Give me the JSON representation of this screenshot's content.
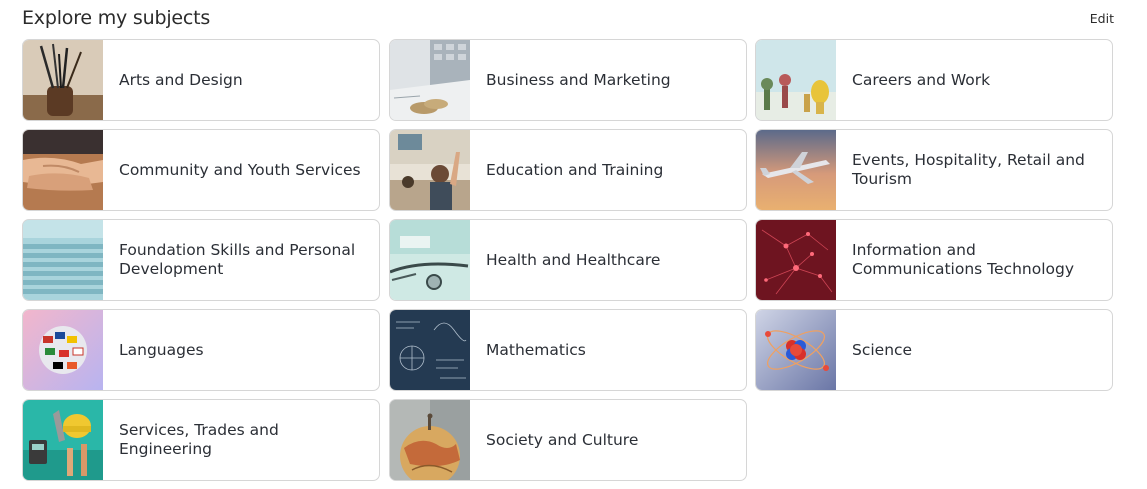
{
  "header": {
    "title": "Explore my subjects",
    "edit_label": "Edit"
  },
  "subjects": [
    {
      "label": "Arts and Design",
      "icon": "art-brushes-image"
    },
    {
      "label": "Business and Marketing",
      "icon": "calculator-coins-image"
    },
    {
      "label": "Careers and Work",
      "icon": "tools-hands-image"
    },
    {
      "label": "Community and Youth Services",
      "icon": "holding-hands-image"
    },
    {
      "label": "Education and Training",
      "icon": "classroom-hand-raised-image"
    },
    {
      "label": "Events, Hospitality, Retail and Tourism",
      "icon": "airplane-sunset-image"
    },
    {
      "label": "Foundation Skills and Personal Development",
      "icon": "staircase-image"
    },
    {
      "label": "Health and Healthcare",
      "icon": "stethoscope-image"
    },
    {
      "label": "Information and Communications Technology",
      "icon": "network-nodes-image"
    },
    {
      "label": "Languages",
      "icon": "globe-flags-image"
    },
    {
      "label": "Mathematics",
      "icon": "chalkboard-formulas-image"
    },
    {
      "label": "Science",
      "icon": "atom-model-image"
    },
    {
      "label": "Services, Trades and Engineering",
      "icon": "trade-tools-image"
    },
    {
      "label": "Society and Culture",
      "icon": "globe-image"
    }
  ]
}
